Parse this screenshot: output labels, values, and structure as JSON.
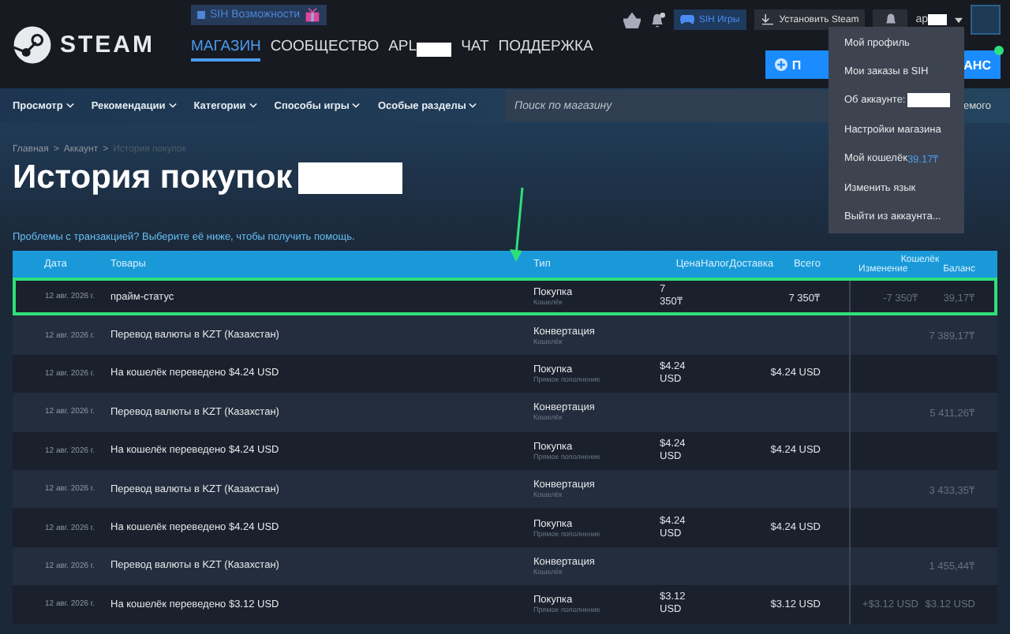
{
  "banner": {
    "label": "SIH Возможности"
  },
  "logo": {
    "text": "STEAM"
  },
  "nav": [
    {
      "label": "МАГАЗИН",
      "selected": true,
      "redacted": false
    },
    {
      "label": "СООБЩЕСТВО",
      "selected": false,
      "redacted": false
    },
    {
      "label": "APL",
      "selected": false,
      "redacted": true
    },
    {
      "label": "ЧАТ",
      "selected": false,
      "redacted": false
    },
    {
      "label": "ПОДДЕРЖКА",
      "selected": false,
      "redacted": false
    }
  ],
  "header_actions": {
    "sih_button": "SIH Игры",
    "install_button": "Установить Steam",
    "account": "ap",
    "account_redacted": true,
    "notification_dot": true
  },
  "promo_button": {
    "left": "П",
    "right": "АНС"
  },
  "store_menu": [
    "Просмотр",
    "Рекомендации",
    "Категории",
    "Способы игры",
    "Особые разделы"
  ],
  "search": {
    "placeholder": "Поиск по магазину"
  },
  "search_side_text": "емого",
  "account_menu": [
    {
      "label": "Мой профиль",
      "redacted": false
    },
    {
      "label": "Мои заказы в SIH",
      "redacted": false
    },
    {
      "label": "Об аккаунте:",
      "redacted": true
    },
    {
      "label": "Настройки магазина",
      "redacted": false
    },
    {
      "label": "Мой кошелёк",
      "value": "39.17₸",
      "redacted": false
    },
    {
      "label": "Изменить язык",
      "redacted": false
    },
    {
      "label": "Выйти из аккаунта...",
      "redacted": false
    }
  ],
  "breadcrumb": [
    {
      "label": "Главная",
      "current": false
    },
    {
      "label": "Аккаунт",
      "current": false
    },
    {
      "label": "История покупок",
      "current": true
    }
  ],
  "breadcrumb_separator": ">",
  "title": "История покупок",
  "title_redacted": true,
  "help_text": "Проблемы с транзакцией? Выберите её ниже, чтобы получить помощь.",
  "table": {
    "columns": [
      "Дата",
      "Товары",
      "Тип",
      "Цена",
      "НалогДоставка",
      "Всего"
    ],
    "wallet": {
      "label": "Кошелёк",
      "columns": [
        "Изменение",
        "Баланс"
      ]
    },
    "rows": [
      {
        "date": "12 авг. 2026 г.",
        "item": "прайм-статус",
        "type": "Покупка",
        "subtype": "Кошелёк",
        "price": "7 350₸",
        "total": "7 350₸",
        "change": "-7 350₸",
        "balance": "39,17₸",
        "highlighted": true
      },
      {
        "date": "12 авг. 2026 г.",
        "item": "Перевод валюты в KZT (Казахстан)",
        "type": "Конвертация",
        "subtype": "Кошелёк",
        "balance": "7 389,17₸",
        "highlighted": false
      },
      {
        "date": "12 авг. 2026 г.",
        "item": "На кошелёк переведено $4.24 USD",
        "type": "Покупка",
        "subtype": "Прямое пополнение",
        "price": "$4.24 USD",
        "total": "$4.24 USD",
        "highlighted": false
      },
      {
        "date": "12 авг. 2026 г.",
        "item": "Перевод валюты в KZT (Казахстан)",
        "type": "Конвертация",
        "subtype": "Кошелёк",
        "balance": "5 411,26₸",
        "highlighted": false
      },
      {
        "date": "12 авг. 2026 г.",
        "item": "На кошелёк переведено $4.24 USD",
        "type": "Покупка",
        "subtype": "Прямое пополнение",
        "price": "$4.24 USD",
        "total": "$4.24 USD",
        "highlighted": false
      },
      {
        "date": "12 авг. 2026 г.",
        "item": "Перевод валюты в KZT (Казахстан)",
        "type": "Конвертация",
        "subtype": "Кошелёк",
        "balance": "3 433,35₸",
        "highlighted": false
      },
      {
        "date": "12 авг. 2026 г.",
        "item": "На кошелёк переведено $4.24 USD",
        "type": "Покупка",
        "subtype": "Прямое пополнение",
        "price": "$4.24 USD",
        "total": "$4.24 USD",
        "highlighted": false
      },
      {
        "date": "12 авг. 2026 г.",
        "item": "Перевод валюты в KZT (Казахстан)",
        "type": "Конвертация",
        "subtype": "Кошелёк",
        "balance": "1 455,44₸",
        "highlighted": false
      },
      {
        "date": "12 авг. 2026 г.",
        "item": "На кошелёк переведено $3.12 USD",
        "type": "Покупка",
        "subtype": "Прямое пополнение",
        "price": "$3.12 USD",
        "total": "$3.12 USD",
        "change": "+$3.12 USD",
        "balance": "$3.12 USD",
        "highlighted": false
      }
    ]
  }
}
